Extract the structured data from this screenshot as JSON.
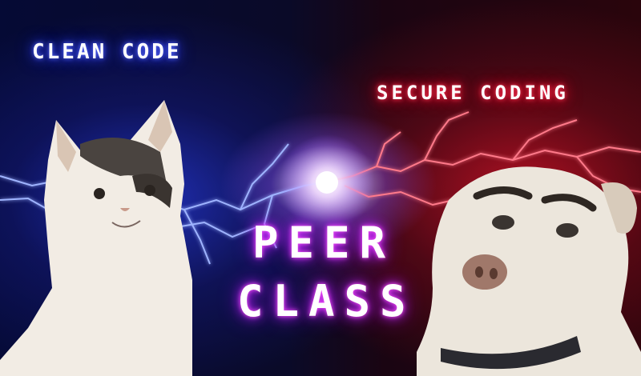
{
  "labels": {
    "left": "CLEAN CODE",
    "right": "SECURE CODING"
  },
  "title": {
    "line1": "PEER",
    "line2": "CLASS"
  },
  "colors": {
    "left_glow": "#3040ff",
    "right_glow": "#ff1030",
    "title_glow": "#c020ff",
    "background": "#0a0a28"
  },
  "subjects": {
    "left": "cat",
    "right": "dog"
  }
}
